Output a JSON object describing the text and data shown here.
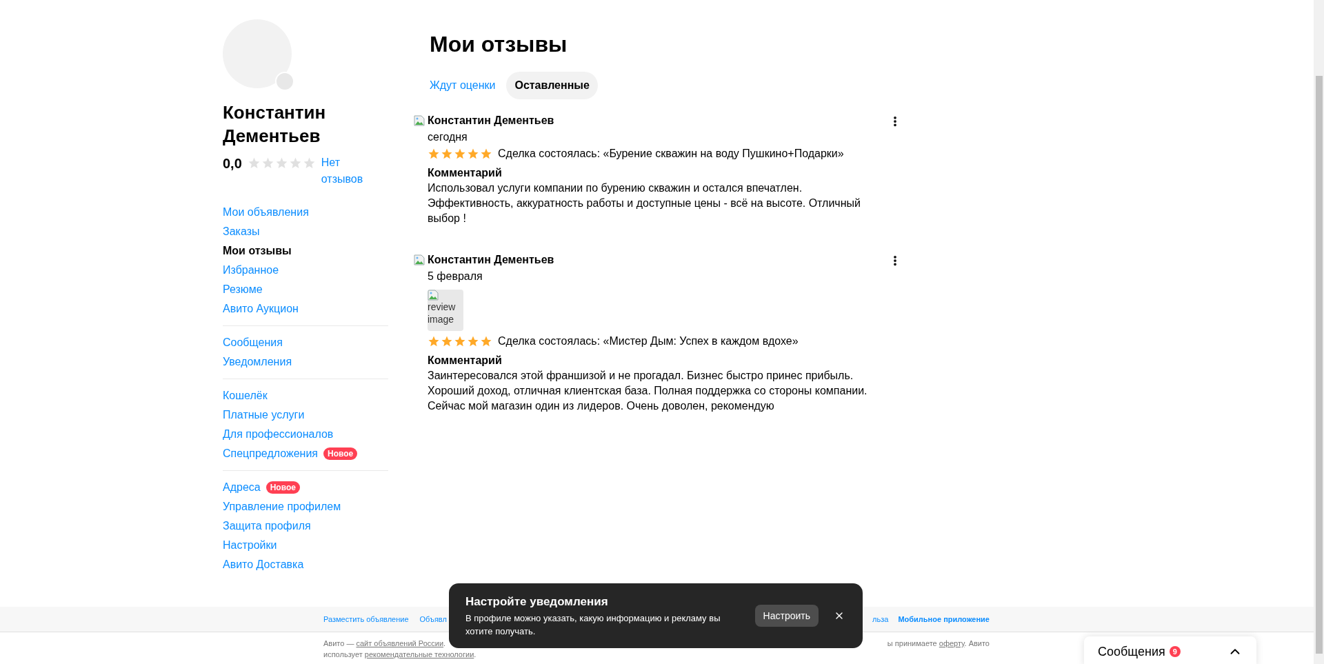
{
  "profile": {
    "name": "Константин Дементьев",
    "rating": "0,0",
    "stars": 0,
    "reviews_link": "Нет отзывов"
  },
  "sidebar": {
    "groups": [
      [
        {
          "label": "Мои объявления",
          "selected": false
        },
        {
          "label": "Заказы",
          "selected": false
        },
        {
          "label": "Мои отзывы",
          "selected": true
        },
        {
          "label": "Избранное",
          "selected": false
        },
        {
          "label": "Резюме",
          "selected": false
        },
        {
          "label": "Авито Аукцион",
          "selected": false
        }
      ],
      [
        {
          "label": "Сообщения",
          "selected": false
        },
        {
          "label": "Уведомления",
          "selected": false
        }
      ],
      [
        {
          "label": "Кошелёк",
          "selected": false
        },
        {
          "label": "Платные услуги",
          "selected": false
        },
        {
          "label": "Для профессионалов",
          "selected": false
        },
        {
          "label": "Спецпредложения",
          "selected": false,
          "badge": "Новое"
        }
      ],
      [
        {
          "label": "Адреса",
          "selected": false,
          "badge": "Новое"
        },
        {
          "label": "Управление профилем",
          "selected": false
        },
        {
          "label": "Защита профиля",
          "selected": false
        },
        {
          "label": "Настройки",
          "selected": false
        },
        {
          "label": "Авито Доставка",
          "selected": false
        }
      ]
    ]
  },
  "title": "Мои отзывы",
  "tabs": [
    {
      "label": "Ждут оценки",
      "selected": false
    },
    {
      "label": "Оставленные",
      "selected": true
    }
  ],
  "reviews": [
    {
      "author": "Константин Дементьев",
      "date": "сегодня",
      "stars": 5,
      "deal": "Сделка состоялась: «Бурение скважин на воду Пушкино+Подарки»",
      "comment_title": "Комментарий",
      "comment": "Использовал услуги компании по бурению скважин и остался впечатлен. Эффективность, аккуратность работы и доступные цены - всё на высоте. Отличный выбор !"
    },
    {
      "author": "Константин Дементьев",
      "date": "5 февраля",
      "images": [
        {
          "alt": "review image"
        }
      ],
      "stars": 5,
      "deal": "Сделка состоялась: «Мистер Дым: Успех в каждом вдохе»",
      "comment_title": "Комментарий",
      "comment": "Заинтересовался этой франшизой и не прогадал. Бизнес быстро принес прибыль. Хороший доход, отличная клиентская база. Полная поддержка со стороны компании. Сейчас мой магазин один из лидеров. Очень доволен, рекомендую"
    }
  ],
  "footer": {
    "links_left": [
      {
        "label": "Разместить объявление",
        "bold": false
      },
      {
        "label": "Объявл",
        "bold": false
      }
    ],
    "links_right": [
      {
        "label": "льза",
        "bold": false
      },
      {
        "label": "Мобильное приложение",
        "bold": true
      }
    ],
    "legal_left": [
      {
        "text": "Авито — "
      },
      {
        "text": "сайт объявлений России",
        "link": true
      },
      {
        "text": "."
      }
    ],
    "legal_right": [
      {
        "text": "ы принимаете "
      },
      {
        "text": "оферту",
        "link": true
      },
      {
        "text": ". Авито"
      }
    ],
    "legal_line2": [
      {
        "text": "использует "
      },
      {
        "text": "рекомендательные технологии",
        "link": true
      },
      {
        "text": "."
      }
    ]
  },
  "toast": {
    "title": "Настройте уведомления",
    "text": "В профиле можно указать, какую информацию и рекламу вы хотите получать.",
    "button": "Настроить"
  },
  "messages_widget": {
    "label": "Сообщения",
    "count": "9"
  }
}
